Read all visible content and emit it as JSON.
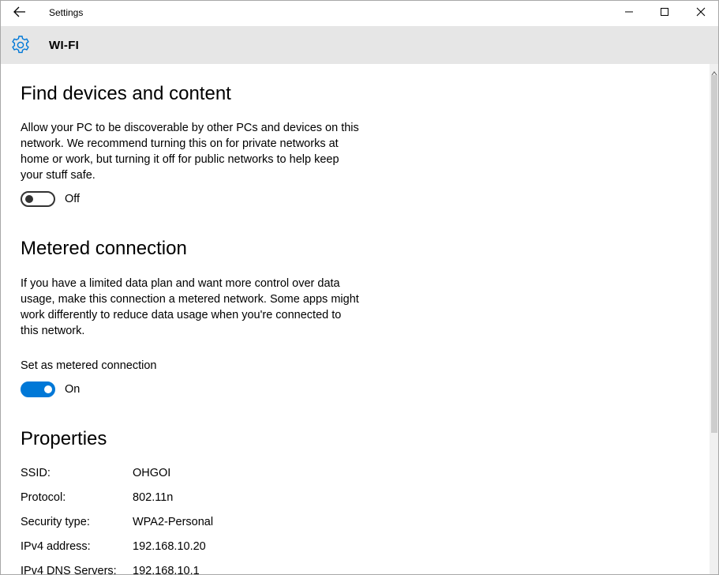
{
  "window": {
    "title": "Settings",
    "back_icon": "arrow-left-icon",
    "minimize_icon": "minimize-icon",
    "maximize_icon": "maximize-icon",
    "close_icon": "close-icon"
  },
  "header": {
    "icon": "gear-icon",
    "title": "WI-FI",
    "accent_color": "#0078d7"
  },
  "sections": {
    "find_devices": {
      "heading": "Find devices and content",
      "description_lines": [
        "Allow your PC to be discoverable by other PCs and devices on this",
        "network. We recommend turning this on for private networks at",
        "home or work, but turning it off for public networks to help keep",
        "your stuff safe."
      ],
      "toggle_state": "off",
      "toggle_label": "Off"
    },
    "metered": {
      "heading": "Metered connection",
      "description_lines": [
        "If you have a limited data plan and want more control over data",
        "usage, make this connection a metered network. Some apps might",
        "work differently to reduce data usage when you're connected to",
        "this network."
      ],
      "setting_label": "Set as metered connection",
      "toggle_state": "on",
      "toggle_label": "On"
    },
    "properties": {
      "heading": "Properties",
      "rows": [
        {
          "key": "SSID:",
          "value": "OHGOI"
        },
        {
          "key": "Protocol:",
          "value": "802.11n"
        },
        {
          "key": "Security type:",
          "value": "WPA2-Personal"
        },
        {
          "key": "IPv4 address:",
          "value": "192.168.10.20"
        },
        {
          "key": "IPv4 DNS Servers:",
          "value": "192.168.10.1"
        }
      ]
    }
  },
  "scrollbar": {
    "position_fraction": 0.0
  }
}
